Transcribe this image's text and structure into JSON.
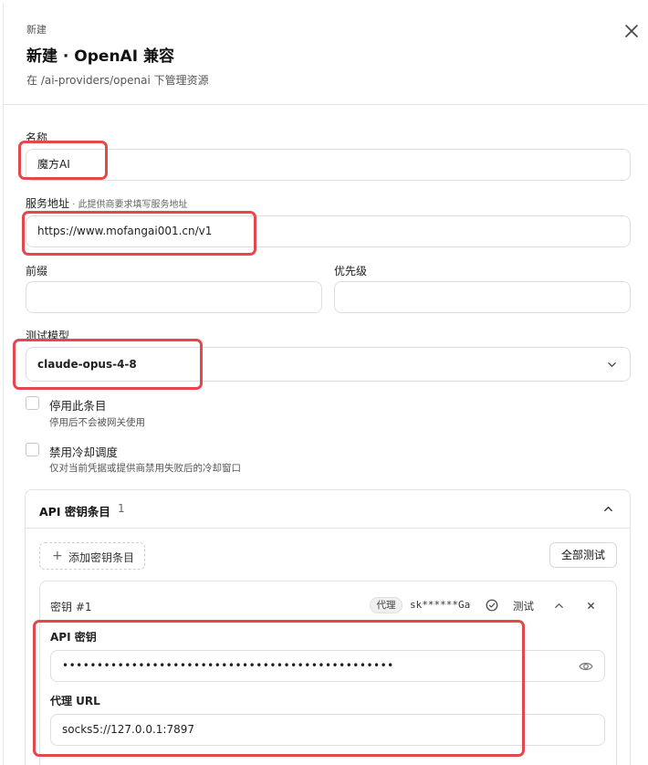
{
  "header": {
    "eyebrow": "新建",
    "title": "新建 · OpenAI 兼容",
    "subtitle": "在 /ai-providers/openai 下管理资源"
  },
  "form": {
    "name": {
      "label": "名称",
      "value": "魔方AI"
    },
    "service_url": {
      "label": "服务地址",
      "hint": " · 此提供商要求填写服务地址",
      "value": "https://www.mofangai001.cn/v1"
    },
    "prefix": {
      "label": "前缀",
      "value": ""
    },
    "priority": {
      "label": "优先级",
      "value": ""
    },
    "test_model": {
      "label": "测试模型",
      "value": "claude-opus-4-8"
    },
    "disable_entry": {
      "title": "停用此条目",
      "desc": "停用后不会被网关使用",
      "checked": false
    },
    "disable_cooldown": {
      "title": "禁用冷却调度",
      "desc": "仅对当前凭据或提供商禁用失败后的冷却窗口",
      "checked": false
    }
  },
  "api_keys": {
    "title": "API 密钥条目",
    "count": "1",
    "add_label": "添加密钥条目",
    "test_all_label": "全部测试",
    "items": [
      {
        "name": "密钥 #1",
        "badge": "代理",
        "masked": "sk******Ga",
        "test_label": "测试",
        "key_label": "API 密钥",
        "key_value": "••••••••••••••••••••••••••••••••••••••••••••••••",
        "proxy_label": "代理 URL",
        "proxy_value": "socks5://127.0.0.1:7897"
      }
    ]
  },
  "colors": {
    "highlight": "#e4484c",
    "border": "#dedede"
  }
}
